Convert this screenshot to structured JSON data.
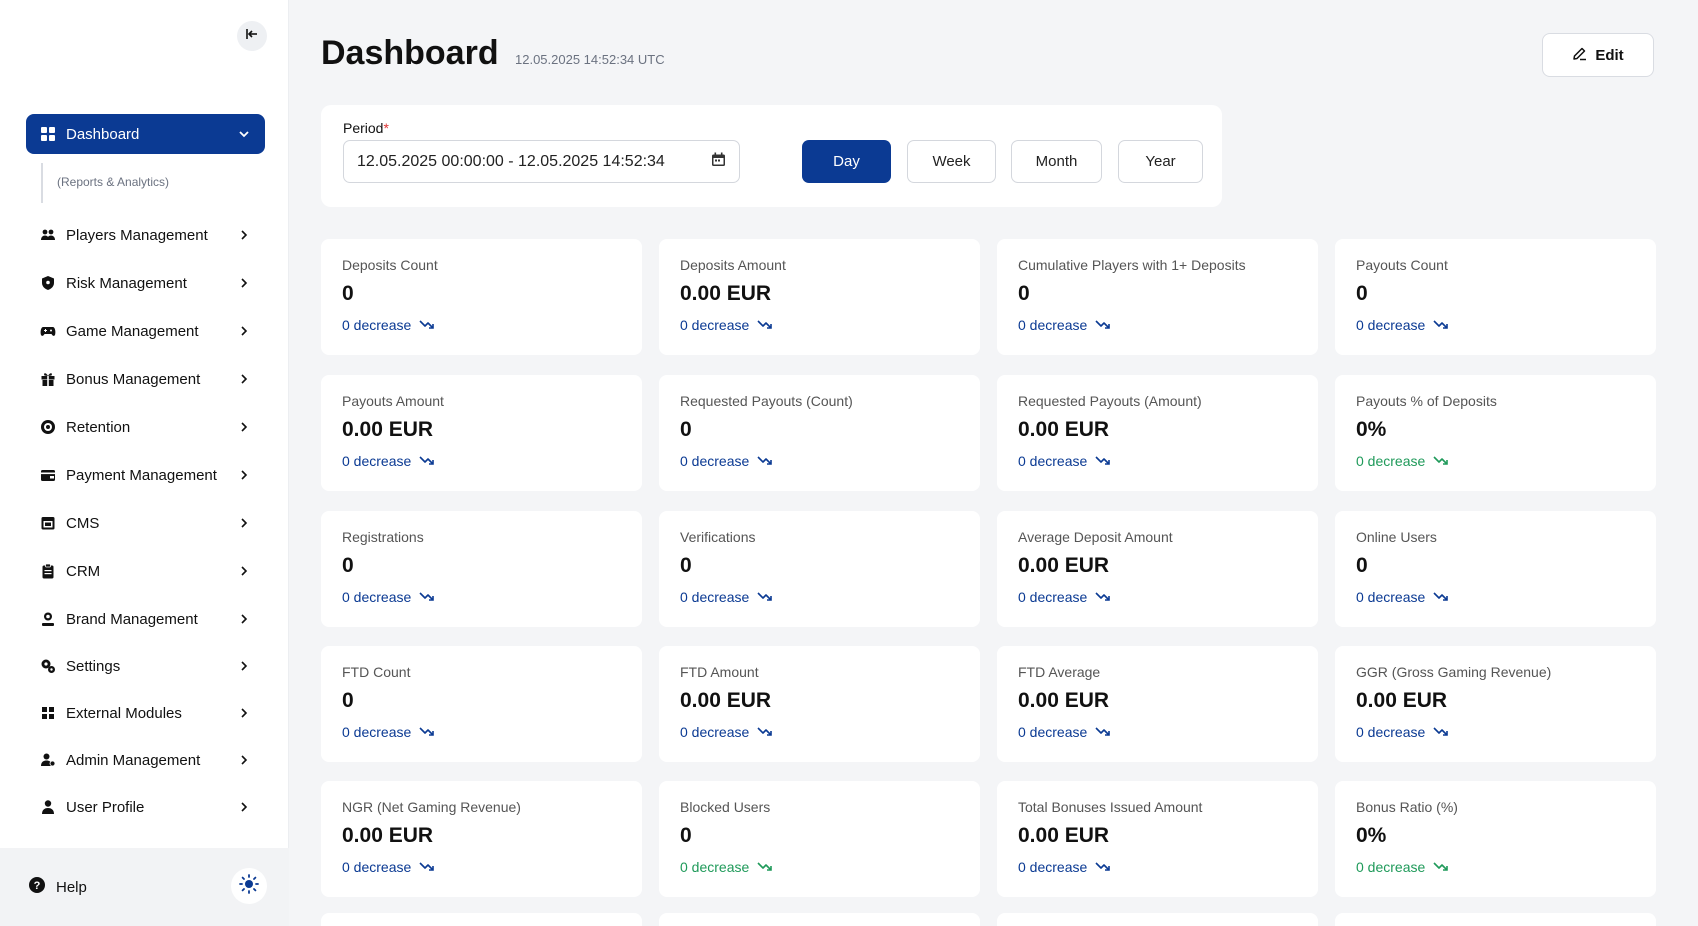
{
  "colors": {
    "primary": "#0b3a93",
    "positive": "#1f9a5a",
    "background": "#f4f5f7"
  },
  "sidebar": {
    "collapse_icon": "sidebar-collapse-icon",
    "active_item": {
      "label": "Dashboard",
      "icon": "dashboard-grid-icon"
    },
    "sub_item": "(Reports & Analytics)",
    "items": [
      {
        "label": "Players Management",
        "icon": "users-icon"
      },
      {
        "label": "Risk Management",
        "icon": "shield-icon"
      },
      {
        "label": "Game Management",
        "icon": "gamepad-icon"
      },
      {
        "label": "Bonus Management",
        "icon": "gift-icon"
      },
      {
        "label": "Retention",
        "icon": "target-icon"
      },
      {
        "label": "Payment Management",
        "icon": "wallet-icon"
      },
      {
        "label": "CMS",
        "icon": "cms-icon"
      },
      {
        "label": "CRM",
        "icon": "clipboard-icon"
      },
      {
        "label": "Brand Management",
        "icon": "brand-icon"
      },
      {
        "label": "Settings",
        "icon": "gears-icon"
      },
      {
        "label": "External Modules",
        "icon": "grid-icon"
      },
      {
        "label": "Admin Management",
        "icon": "admin-icon"
      },
      {
        "label": "User Profile",
        "icon": "user-icon"
      }
    ],
    "help_label": "Help",
    "theme_icon": "sun-icon"
  },
  "header": {
    "title": "Dashboard",
    "timestamp": "12.05.2025 14:52:34 UTC",
    "edit_label": "Edit"
  },
  "period": {
    "label": "Period",
    "required_mark": "*",
    "value": "12.05.2025 00:00:00 - 12.05.2025 14:52:34",
    "options": [
      "Day",
      "Week",
      "Month",
      "Year"
    ],
    "selected": "Day"
  },
  "cards": [
    {
      "title": "Deposits Count",
      "value": "0",
      "change": "0 decrease",
      "tone": "blue"
    },
    {
      "title": "Deposits Amount",
      "value": "0.00 EUR",
      "change": "0 decrease",
      "tone": "blue"
    },
    {
      "title": "Cumulative Players with 1+ Deposits",
      "value": "0",
      "change": "0 decrease",
      "tone": "blue"
    },
    {
      "title": "Payouts Count",
      "value": "0",
      "change": "0 decrease",
      "tone": "blue"
    },
    {
      "title": "Payouts Amount",
      "value": "0.00 EUR",
      "change": "0 decrease",
      "tone": "blue"
    },
    {
      "title": "Requested Payouts (Count)",
      "value": "0",
      "change": "0 decrease",
      "tone": "blue"
    },
    {
      "title": "Requested Payouts (Amount)",
      "value": "0.00 EUR",
      "change": "0 decrease",
      "tone": "blue"
    },
    {
      "title": "Payouts % of Deposits",
      "value": "0%",
      "change": "0 decrease",
      "tone": "green"
    },
    {
      "title": "Registrations",
      "value": "0",
      "change": "0 decrease",
      "tone": "blue"
    },
    {
      "title": "Verifications",
      "value": "0",
      "change": "0 decrease",
      "tone": "blue"
    },
    {
      "title": "Average Deposit Amount",
      "value": "0.00 EUR",
      "change": "0 decrease",
      "tone": "blue"
    },
    {
      "title": "Online Users",
      "value": "0",
      "change": "0 decrease",
      "tone": "blue"
    },
    {
      "title": "FTD Count",
      "value": "0",
      "change": "0 decrease",
      "tone": "blue"
    },
    {
      "title": "FTD Amount",
      "value": "0.00 EUR",
      "change": "0 decrease",
      "tone": "blue"
    },
    {
      "title": "FTD Average",
      "value": "0.00 EUR",
      "change": "0 decrease",
      "tone": "blue"
    },
    {
      "title": "GGR (Gross Gaming Revenue)",
      "value": "0.00 EUR",
      "change": "0 decrease",
      "tone": "blue"
    },
    {
      "title": "NGR (Net Gaming Revenue)",
      "value": "0.00 EUR",
      "change": "0 decrease",
      "tone": "blue"
    },
    {
      "title": "Blocked Users",
      "value": "0",
      "change": "0 decrease",
      "tone": "green"
    },
    {
      "title": "Total Bonuses Issued Amount",
      "value": "0.00 EUR",
      "change": "0 decrease",
      "tone": "blue"
    },
    {
      "title": "Bonus Ratio (%)",
      "value": "0%",
      "change": "0 decrease",
      "tone": "green"
    }
  ]
}
